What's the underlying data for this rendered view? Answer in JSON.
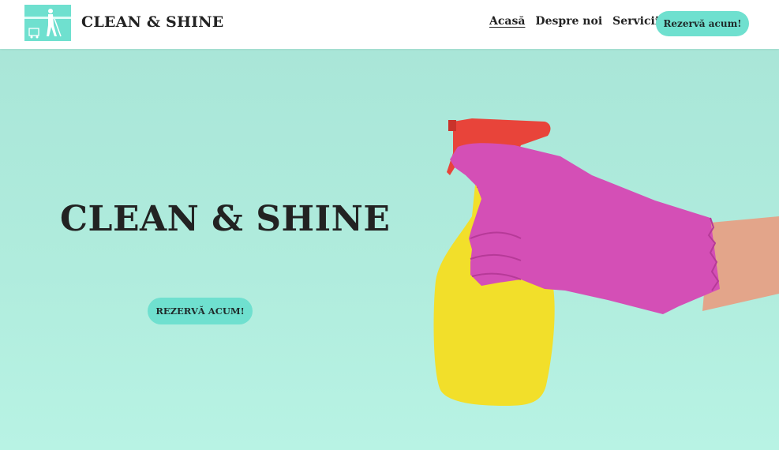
{
  "header": {
    "logo": {
      "alt": "Clean & Shine logo",
      "color": "#6fe0cf"
    },
    "site_title": "CLEAN & SHINE",
    "nav": [
      {
        "label": "Acasă",
        "active": true
      },
      {
        "label": "Despre noi",
        "active": false
      },
      {
        "label": "Servicii",
        "active": false
      }
    ],
    "cta_label": "Rezervă acum!"
  },
  "hero": {
    "title": "CLEAN & SHINE",
    "cta_label": "REZERVĂ ACUM!",
    "image": {
      "alt": "Pink gloved hand holding a yellow spray bottle with a red trigger"
    }
  },
  "colors": {
    "accent": "#6fe0cf",
    "hero_bg": "#b0ecdd",
    "glove": "#d44fb6",
    "bottle": "#f2df2a",
    "trigger": "#e8443a",
    "text": "#222222"
  }
}
